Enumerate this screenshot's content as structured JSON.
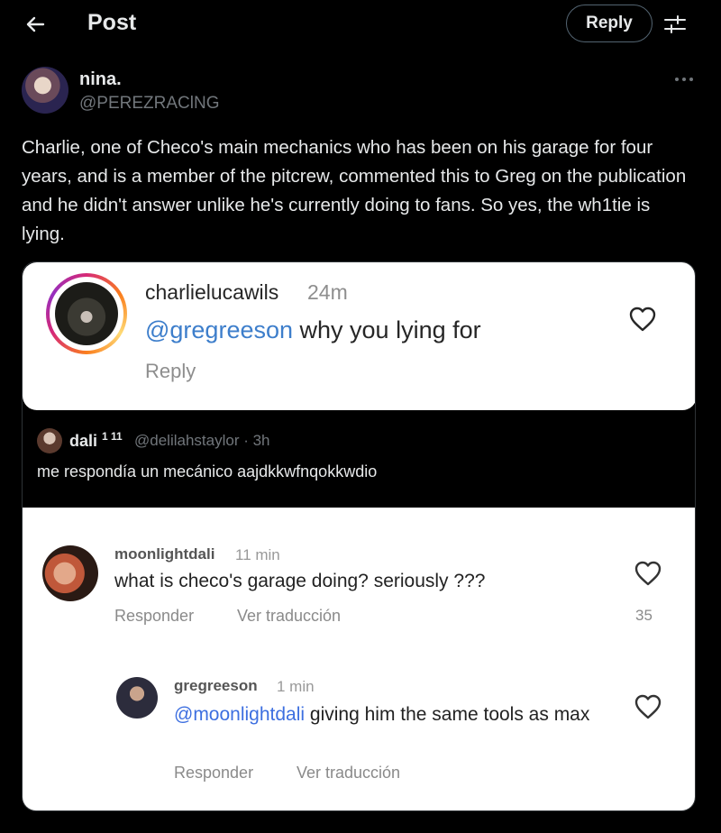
{
  "header": {
    "title": "Post",
    "reply_label": "Reply"
  },
  "post": {
    "author_name": "nina.",
    "author_handle": "@PEREZRAClNG",
    "text": "Charlie, one of Checo's main mechanics who has been on his garage for four years, and is a member of the pitcrew, commented this to Greg on the publication and he didn't answer unlike he's currently doing to fans. So yes, the wh1tie is lying."
  },
  "image": {
    "instagram": {
      "username": "charlielucawils",
      "time": "24m",
      "mention": "@gregreeson",
      "comment": " why you lying for",
      "reply_label": "Reply"
    },
    "quoted_tweet": {
      "name": "dali",
      "name_sup": "1 11",
      "handle_time": "@delilahstaylor · 3h",
      "text": "me respondía un mecánico aajdkkwfnqokkwdio"
    },
    "tiktok": {
      "comment1": {
        "username": "moonlightdali",
        "time": "11 min",
        "text": "what is checo's garage doing? seriously ???",
        "reply_label": "Responder",
        "translate_label": "Ver traducción",
        "likes": "35"
      },
      "comment2": {
        "username": "gregreeson",
        "time": "1 min",
        "mention": "@moonlightdali",
        "text": " giving him the same tools as max",
        "reply_label": "Responder",
        "translate_label": "Ver traducción"
      }
    }
  }
}
